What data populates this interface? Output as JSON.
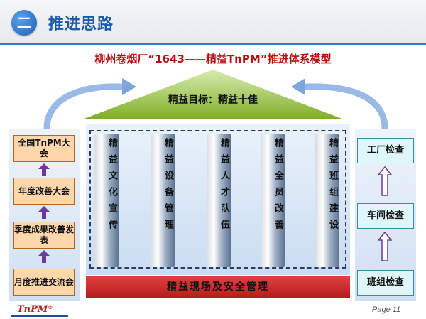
{
  "header": {
    "section_number": "二",
    "section_title": "推进思路"
  },
  "model_title": "柳州卷烟厂“1643——精益TnPM”推进体系模型",
  "roof": {
    "label": "精益目标：精益十佳"
  },
  "pillars": [
    {
      "label": "精益文化宣传"
    },
    {
      "label": "精益设备管理"
    },
    {
      "label": "精益人才队伍"
    },
    {
      "label": "精益全员改善"
    },
    {
      "label": "精益班组建设"
    }
  ],
  "foundation": {
    "label": "精益现场及安全管理"
  },
  "left_steps": [
    {
      "label": "全国TnPM大会"
    },
    {
      "label": "年度改善大会"
    },
    {
      "label": "季度成果改善发表"
    },
    {
      "label": "月度推进交流会"
    }
  ],
  "right_checks": [
    {
      "label": "工厂检查"
    },
    {
      "label": "车间检查"
    },
    {
      "label": "班组检查"
    }
  ],
  "footer": {
    "logo_text": "TnPM",
    "logo_mark": "®",
    "page_label": "Page 11"
  },
  "colors": {
    "accent_blue": "#1e5aa8",
    "title_red": "#b80f12",
    "roof_green": "#8fbf2e",
    "foundation_red": "#c82222",
    "step_orange": "#ffd7aa",
    "check_cyan": "#dff7fb",
    "arrow_purple": "#6a3a9c"
  }
}
